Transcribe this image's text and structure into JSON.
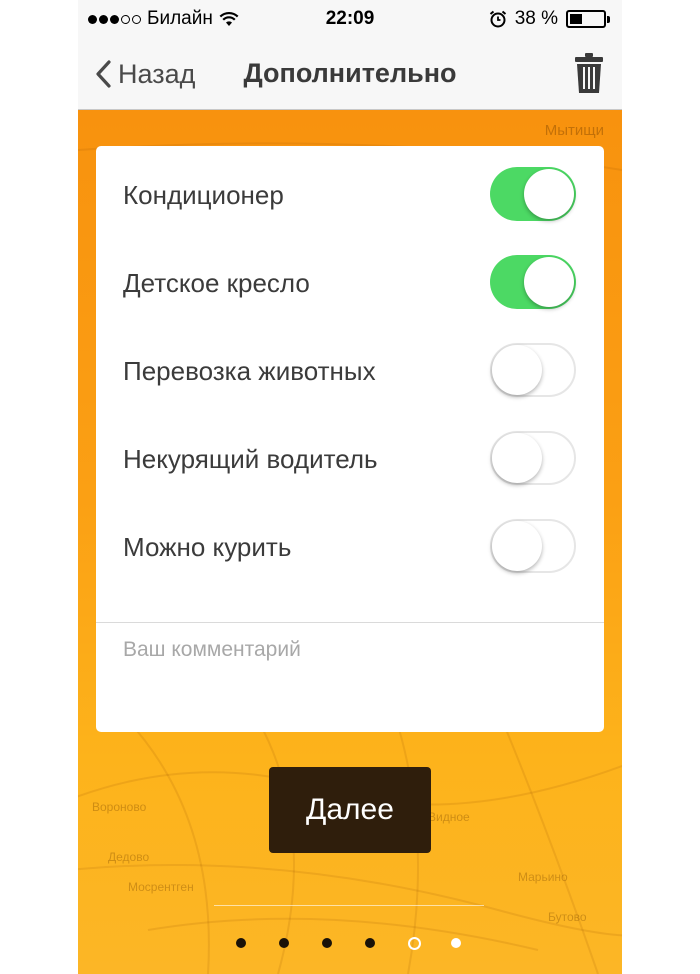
{
  "status_bar": {
    "carrier": "Билайн",
    "time": "22:09",
    "battery_text": "38 %",
    "battery_level": 0.38
  },
  "nav": {
    "back_label": "Назад",
    "title": "Дополнительно"
  },
  "options": [
    {
      "label": "Кондиционер",
      "enabled": true
    },
    {
      "label": "Детское кресло",
      "enabled": true
    },
    {
      "label": "Перевозка животных",
      "enabled": false
    },
    {
      "label": "Некурящий водитель",
      "enabled": false
    },
    {
      "label": "Можно курить",
      "enabled": false
    }
  ],
  "comment": {
    "placeholder": "Ваш комментарий",
    "value": ""
  },
  "next_button": {
    "label": "Далее"
  },
  "pagination": {
    "total": 6,
    "current": 5
  },
  "map": {
    "city_label": "Мытищи",
    "labels": [
      "Мосрентген",
      "Вороново",
      "Марьино",
      "Бутово",
      "Видное",
      "Дедово"
    ]
  },
  "colors": {
    "accent_green": "#4cd964",
    "background_orange": "#f8920e",
    "button_dark": "#2f1e0c"
  },
  "icons": {
    "back": "chevron-left-icon",
    "trash": "trash-icon",
    "wifi": "wifi-icon",
    "alarm": "alarm-icon",
    "battery": "battery-icon"
  }
}
